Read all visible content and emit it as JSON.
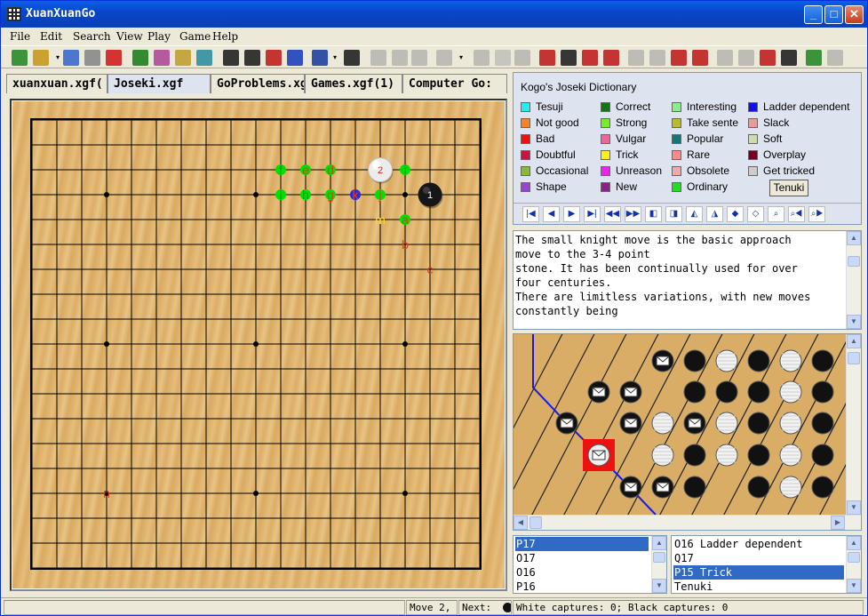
{
  "window": {
    "title": "XuanXuanGo"
  },
  "menu": [
    "File",
    "Edit",
    "Search",
    "View",
    "Play",
    "Game",
    "Help"
  ],
  "toolbar": {
    "icons": [
      "new-game-icon",
      "open-icon",
      "open-dropdown-icon",
      "find-icon",
      "save-icon",
      "close-file-icon",
      "board-edit-icon",
      "board-setup-icon",
      "board-figure-icon",
      "board-print-icon",
      "grid-icon",
      "coordinates-icon",
      "number-moves-icon",
      "swap-icon",
      "refresh-icon",
      "refresh-dropdown-icon",
      "axis-icon",
      "properties-icon",
      "info-icon",
      "eraser-icon",
      "label-icon",
      "label-dropdown-icon",
      "link-icon",
      "plus-icon",
      "hand-icon",
      "record-icon",
      "stones-icon",
      "mark-icon",
      "mark-up-icon",
      "up-icon",
      "down-icon",
      "edit-doc-icon",
      "check-doc-icon",
      "page-icon",
      "blank-icon",
      "grid-red-icon",
      "panda-icon",
      "go-icon",
      "stop-icon"
    ]
  },
  "tabs": [
    {
      "label": "xuanxuan.xgf(",
      "active": false
    },
    {
      "label": "Joseki.xgf",
      "active": true
    },
    {
      "label": "GoProblems.xg",
      "active": false
    },
    {
      "label": "Games.xgf(1)",
      "active": false
    },
    {
      "label": "Computer Go:",
      "active": false
    }
  ],
  "board": {
    "stones": [
      {
        "color": "white",
        "col": 14,
        "row": 2,
        "label": "2"
      },
      {
        "color": "black",
        "col": 16,
        "row": 3,
        "label": "1"
      }
    ],
    "marks": [
      {
        "col": 10,
        "row": 2,
        "text": "f",
        "color": "#00a000",
        "dot": "#00e000"
      },
      {
        "col": 11,
        "row": 2,
        "text": "e",
        "color": "#e83a1a",
        "dot": "#00e000"
      },
      {
        "col": 12,
        "row": 2,
        "text": "d",
        "color": "#e83a1a",
        "dot": "#00e000"
      },
      {
        "col": 15,
        "row": 2,
        "text": "i",
        "color": "#00a000",
        "dot": "#00e000"
      },
      {
        "col": 10,
        "row": 3,
        "text": "i",
        "color": "#00a000",
        "dot": "#00e000"
      },
      {
        "col": 11,
        "row": 3,
        "text": "h",
        "color": "#00a000",
        "dot": "#00e000"
      },
      {
        "col": 12,
        "row": 3,
        "text": "g",
        "color": "#e83a1a",
        "dot": "#00e000"
      },
      {
        "col": 13,
        "row": 3,
        "text": "k",
        "color": "#e83a1a",
        "dot": "#2a2ad8"
      },
      {
        "col": 14,
        "row": 3,
        "text": "j",
        "color": "#e83a1a",
        "dot": "#00e000"
      },
      {
        "col": 14,
        "row": 4,
        "text": "m",
        "color": "#ffe000",
        "dot": null
      },
      {
        "col": 15,
        "row": 4,
        "text": "a",
        "color": "#e83a1a",
        "dot": "#00e000"
      },
      {
        "col": 15,
        "row": 5,
        "text": "b",
        "color": "#e83a1a",
        "dot": null
      },
      {
        "col": 16,
        "row": 6,
        "text": "c",
        "color": "#e83a1a",
        "dot": null
      },
      {
        "col": 3,
        "row": 15,
        "text": "n",
        "color": "#e83a1a",
        "dot": null
      }
    ]
  },
  "dictionary": {
    "title": "Kogo's Joseki Dictionary",
    "legend": [
      {
        "label": "Tesuji",
        "color": "#22eeee"
      },
      {
        "label": "Not good",
        "color": "#ff7f27"
      },
      {
        "label": "Bad",
        "color": "#ee1111"
      },
      {
        "label": "Doubtful",
        "color": "#cc1144"
      },
      {
        "label": "Occasional",
        "color": "#88bb33"
      },
      {
        "label": "Shape",
        "color": "#9944cc"
      },
      {
        "label": "Correct",
        "color": "#117711"
      },
      {
        "label": "Strong",
        "color": "#77ee22"
      },
      {
        "label": "Vulgar",
        "color": "#ee6699"
      },
      {
        "label": "Trick",
        "color": "#ffee22"
      },
      {
        "label": "Unreason",
        "color": "#ee22ee"
      },
      {
        "label": "New",
        "color": "#882288"
      },
      {
        "label": "Interesting",
        "color": "#88ee88"
      },
      {
        "label": "Take sente",
        "color": "#bbbb22"
      },
      {
        "label": "Popular",
        "color": "#117777"
      },
      {
        "label": "Rare",
        "color": "#ff8888"
      },
      {
        "label": "Obsolete",
        "color": "#eeaaaa"
      },
      {
        "label": "Ordinary",
        "color": "#22dd22"
      },
      {
        "label": "Ladder dependent",
        "color": "#1111ee"
      },
      {
        "label": "Slack",
        "color": "#ee9999"
      },
      {
        "label": "Soft",
        "color": "#ccddaa"
      },
      {
        "label": "Overplay",
        "color": "#770022"
      },
      {
        "label": "Get tricked",
        "color": "#cccccc"
      }
    ],
    "tenuki_label": "Tenuki",
    "nav_icons": [
      "first-icon",
      "prev-icon",
      "next-icon",
      "last-icon",
      "branch-prev-icon",
      "branch-next-icon",
      "comment-prev-icon",
      "comment-next-icon",
      "mark-prev-icon",
      "mark-next-icon",
      "variation-prev-icon",
      "variation-next-icon",
      "binoculars-icon",
      "search-prev-icon",
      "search-next-icon"
    ]
  },
  "comment": {
    "text": "The small knight move is the basic approach\nmove to the 3-4 point\nstone. It has been continually used for over\nfour centuries.\nThere are limitless variations, with new moves\nconstantly being"
  },
  "left_list": [
    {
      "label": "P17",
      "selected": true
    },
    {
      "label": "O17",
      "selected": false
    },
    {
      "label": "O16",
      "selected": false
    },
    {
      "label": "P16",
      "selected": false
    }
  ],
  "right_list": [
    {
      "label": "O16 Ladder dependent",
      "selected": false
    },
    {
      "label": "Q17",
      "selected": false
    },
    {
      "label": "P15 Trick",
      "selected": true
    },
    {
      "label": "Tenuki",
      "selected": false
    }
  ],
  "status": {
    "move": "Move 2,",
    "next_label": "Next:",
    "captures": "White captures: 0; Black captures: 0"
  }
}
